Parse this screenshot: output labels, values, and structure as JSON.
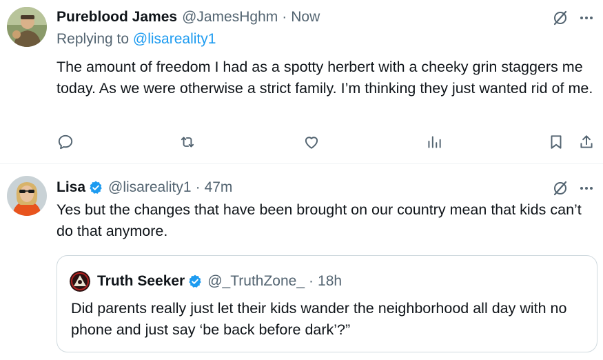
{
  "tweets": [
    {
      "display_name": "Pureblood James",
      "handle": "@JamesHghm",
      "separator": "·",
      "time": "Now",
      "reply_prefix": "Replying to",
      "reply_target": "@lisareality1",
      "text": "The amount of freedom I had as a spotty herbert with a cheeky grin staggers me today. As we were otherwise a strict family. I’m thinking they just wanted rid of me.",
      "avatar_icon": "user-avatar-icon",
      "actions": [
        "reply-icon",
        "retweet-icon",
        "like-icon",
        "views-icon",
        "bookmark-icon",
        "share-icon"
      ]
    },
    {
      "display_name": "Lisa",
      "handle": "@lisareality1",
      "separator": "·",
      "time": "47m",
      "verified": true,
      "text": "Yes but the changes that have been brought on our country mean that kids can’t do that anymore.",
      "avatar_icon": "user-avatar-icon",
      "quote": {
        "display_name": "Truth Seeker",
        "handle": "@_TruthZone_",
        "separator": "·",
        "time": "18h",
        "verified": true,
        "text": "Did parents really just let their kids wander the neighborhood all day with no phone and just say ‘be back before dark’?”"
      }
    }
  ],
  "header_icons": [
    "grok-icon",
    "more-icon"
  ],
  "colors": {
    "text": "#0f1419",
    "secondary": "#536471",
    "link": "#1d9bf0",
    "verified": "#1d9bf0",
    "border": "#cfd9de",
    "divider": "#eff3f4"
  }
}
